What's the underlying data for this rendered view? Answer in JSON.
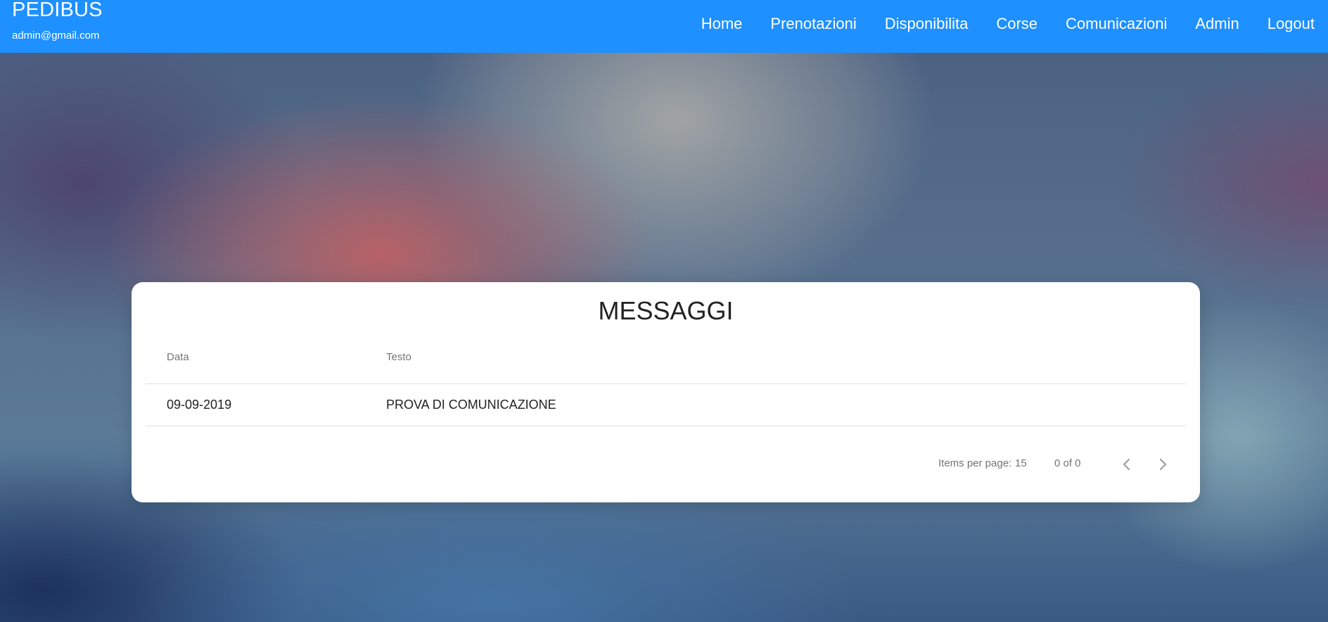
{
  "header": {
    "app_title": "PEDIBUS",
    "user_email": "admin@gmail.com",
    "nav": [
      {
        "label": "Home"
      },
      {
        "label": "Prenotazioni"
      },
      {
        "label": "Disponibilita"
      },
      {
        "label": "Corse"
      },
      {
        "label": "Comunicazioni"
      },
      {
        "label": "Admin"
      },
      {
        "label": "Logout"
      }
    ],
    "bar_color": "#1e90ff"
  },
  "messages": {
    "title": "MESSAGGI",
    "columns": {
      "date": "Data",
      "text": "Testo"
    },
    "rows": [
      {
        "date": "09-09-2019",
        "text": "PROVA DI COMUNICAZIONE"
      }
    ]
  },
  "paginator": {
    "items_per_page_label": "Items per page:",
    "page_size": "15",
    "range_label": "0 of 0",
    "prev_icon": "chevron-left-icon",
    "next_icon": "chevron-right-icon"
  }
}
